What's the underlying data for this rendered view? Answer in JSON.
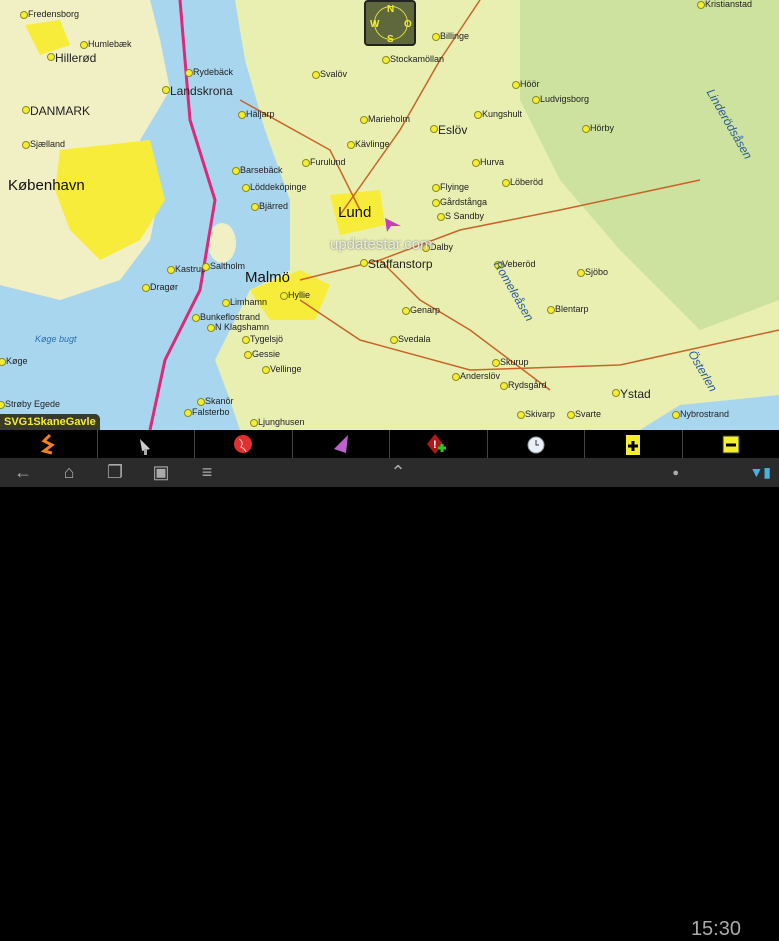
{
  "map": {
    "name_badge": "SVG1SkaneGavle",
    "watermark": "updatestar.com",
    "compass": {
      "n": "N",
      "w": "W",
      "e": "O",
      "s": "S"
    },
    "labels": [
      "Fredensborg",
      "Humlebæk",
      "Hillerød",
      "DANMARK",
      "Sjælland",
      "København",
      "Kastrup",
      "Dragør",
      "Køge bugt",
      "Køge",
      "Strøby Egede",
      "Saltholm",
      "Landskrona",
      "Rydebäck",
      "Häljarp",
      "Barsebäck",
      "Löddeköpinge",
      "Bjärred",
      "Lund",
      "Malmö",
      "Hyllie",
      "Limhamn",
      "Bunkeflostrand",
      "N Klagshamn",
      "Tygelsjö",
      "Gessie",
      "Vellinge",
      "Skanör",
      "Falsterbo",
      "Ljunghusen",
      "Staffanstorp",
      "Eslöv",
      "Kävlinge",
      "Furulund",
      "Svalöv",
      "Marieholm",
      "Stockamöllan",
      "Billinge",
      "Kungshult",
      "Höör",
      "Hörby",
      "Ludvigsborg",
      "Löberöd",
      "Flyinge",
      "Gårdstånga",
      "S Sandby",
      "Veberöd",
      "Sjöbo",
      "Blentarp",
      "Svedala",
      "Skurup",
      "Rydsgård",
      "Skivarp",
      "Svarte",
      "Ystad",
      "Kristianstad",
      "Hurva",
      "Dalby",
      "Genarp",
      "Anderslöv",
      "Linderödsåsen",
      "Romeleåsen",
      "Österlen",
      "Nybrostrand"
    ],
    "colors": {
      "water": "#a9d6ef",
      "land_dk": "#f1efc4",
      "land_se": "#e8efb0",
      "forest": "#c6de9a",
      "urban": "#f7ec3a",
      "border": "#e0287a"
    }
  },
  "toolbar": [
    {
      "icon": "route-icon"
    },
    {
      "icon": "satellite-dish-icon"
    },
    {
      "icon": "globe-icon"
    },
    {
      "icon": "navigation-arrow-icon"
    },
    {
      "icon": "add-warning-icon"
    },
    {
      "icon": "alarm-clock-icon"
    },
    {
      "icon": "zoom-in-icon"
    },
    {
      "icon": "zoom-out-icon"
    }
  ],
  "statusbar": {
    "time": "15:30"
  }
}
